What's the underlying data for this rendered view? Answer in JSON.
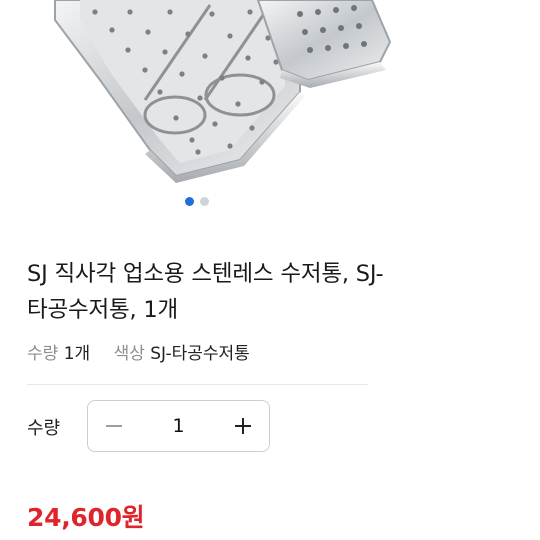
{
  "product_image": {
    "alt": ""
  },
  "carousel": {
    "count": 2,
    "active_index": 0
  },
  "product": {
    "title": "SJ 직사각 업소용 스텐레스 수저통, SJ-타공수저통, 1개",
    "options": [
      {
        "key": "수량",
        "value": "1개"
      },
      {
        "key": "색상",
        "value": "SJ-타공수저통"
      }
    ]
  },
  "quantity": {
    "label": "수량",
    "value": "1",
    "minus_icon": "minus-icon",
    "plus_icon": "plus-icon"
  },
  "price": {
    "text": "24,600원",
    "color": "#e0242c"
  },
  "colors": {
    "accent": "#1f6fd6",
    "dot_inactive": "#cfd3d8"
  }
}
